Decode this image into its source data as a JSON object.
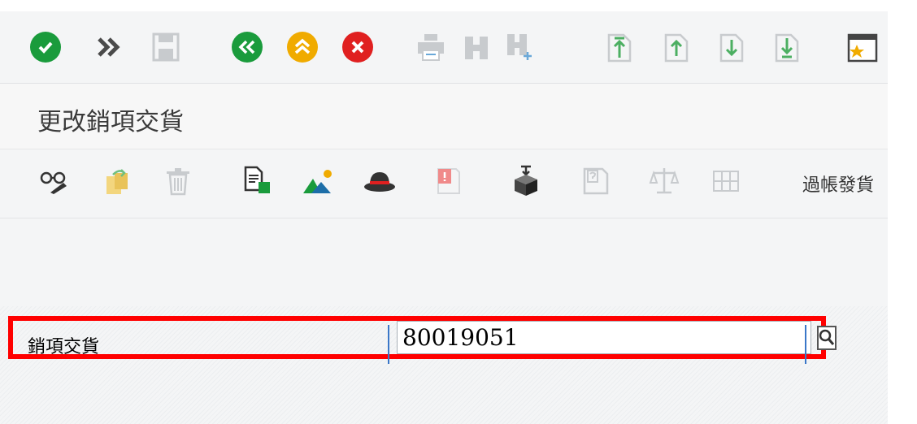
{
  "window": {
    "title": "更改銷項交貨"
  },
  "toolbar": {
    "items": [
      {
        "name": "enter-button",
        "icon": "check-icon",
        "color": "#1a9b3c"
      },
      {
        "name": "command-field-button",
        "icon": "double-chevron-right-icon",
        "color": "#555555"
      },
      {
        "name": "save-button",
        "icon": "save-icon",
        "color": "#c8cbce"
      },
      {
        "name": "back-button",
        "icon": "back-icon",
        "color": "#1a9b3c"
      },
      {
        "name": "exit-button",
        "icon": "exit-icon",
        "color": "#f0ab00"
      },
      {
        "name": "cancel-button",
        "icon": "cancel-icon",
        "color": "#e02020"
      },
      {
        "name": "print-button",
        "icon": "print-icon",
        "color": "#c8cbce"
      },
      {
        "name": "find-button",
        "icon": "binoculars-icon",
        "color": "#c8cbce"
      },
      {
        "name": "find-next-button",
        "icon": "binoculars-plus-icon",
        "color": "#c8cbce"
      },
      {
        "name": "first-page-button",
        "icon": "first-page-icon",
        "color": "#6fbf7f"
      },
      {
        "name": "previous-page-button",
        "icon": "previous-page-icon",
        "color": "#6fbf7f"
      },
      {
        "name": "next-page-button",
        "icon": "next-page-icon",
        "color": "#6fbf7f"
      },
      {
        "name": "last-page-button",
        "icon": "last-page-icon",
        "color": "#6fbf7f"
      },
      {
        "name": "create-shortcut-button",
        "icon": "bookmark-star-icon",
        "color": "#f0ab00"
      }
    ]
  },
  "app_toolbar": {
    "items": [
      {
        "name": "display-change-button",
        "icon": "glasses-pen-icon"
      },
      {
        "name": "copy-button",
        "icon": "copy-arrow-icon"
      },
      {
        "name": "delete-button",
        "icon": "trash-icon"
      },
      {
        "name": "document-flow-button",
        "icon": "document-flow-icon"
      },
      {
        "name": "picking-button",
        "icon": "mountains-icon"
      },
      {
        "name": "hat-button",
        "icon": "hat-icon"
      },
      {
        "name": "error-log-button",
        "icon": "error-log-icon"
      },
      {
        "name": "pack-button",
        "icon": "package-icon"
      },
      {
        "name": "help-document-button",
        "icon": "help-document-icon"
      },
      {
        "name": "balance-button",
        "icon": "balance-scale-icon"
      },
      {
        "name": "grid-button",
        "icon": "grid-icon"
      }
    ],
    "post_goods_issue": "過帳發貨"
  },
  "form": {
    "delivery_label": "銷項交貨",
    "delivery_value": "80019051"
  },
  "colors": {
    "highlight": "#ff0000",
    "background": "#f4f5f6"
  }
}
